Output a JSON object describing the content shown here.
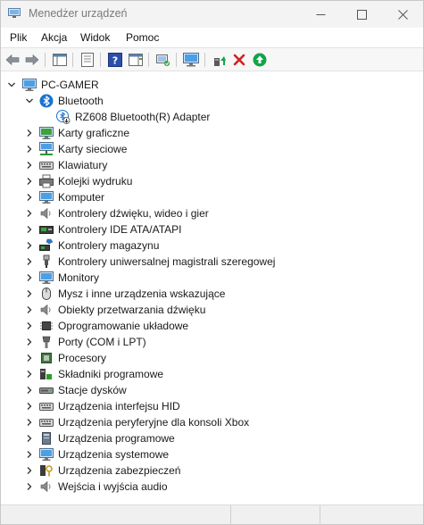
{
  "window": {
    "title": "Menedżer urządzeń"
  },
  "menu": [
    "Plik",
    "Akcja",
    "Widok",
    "Pomoc"
  ],
  "toolbar": {
    "buttons": [
      {
        "name": "back-arrow-icon"
      },
      {
        "name": "forward-arrow-icon"
      },
      {
        "name": "show-hide-console-tree-icon"
      },
      {
        "name": "properties-icon"
      },
      {
        "name": "help-icon"
      },
      {
        "name": "action-pane-icon"
      },
      {
        "name": "scan-hardware-changes-icon"
      },
      {
        "name": "computer-monitor-icon"
      },
      {
        "name": "update-driver-icon"
      },
      {
        "name": "uninstall-device-icon"
      },
      {
        "name": "enable-device-icon"
      }
    ]
  },
  "tree": {
    "root": "PC-GAMER",
    "expanded_category": "Bluetooth",
    "expanded_child": "RZ608 Bluetooth(R) Adapter",
    "categories": [
      {
        "label": "Karty graficzne",
        "icon": "display-adapter-icon"
      },
      {
        "label": "Karty sieciowe",
        "icon": "network-adapter-icon"
      },
      {
        "label": "Klawiatury",
        "icon": "keyboard-icon"
      },
      {
        "label": "Kolejki wydruku",
        "icon": "printer-icon"
      },
      {
        "label": "Komputer",
        "icon": "computer-icon"
      },
      {
        "label": "Kontrolery dźwięku, wideo i gier",
        "icon": "speaker-icon"
      },
      {
        "label": "Kontrolery IDE ATA/ATAPI",
        "icon": "ide-controller-icon"
      },
      {
        "label": "Kontrolery magazynu",
        "icon": "storage-controller-icon"
      },
      {
        "label": "Kontrolery uniwersalnej magistrali szeregowej",
        "icon": "usb-icon"
      },
      {
        "label": "Monitory",
        "icon": "monitor-icon"
      },
      {
        "label": "Mysz i inne urządzenia wskazujące",
        "icon": "mouse-icon"
      },
      {
        "label": "Obiekty przetwarzania dźwięku",
        "icon": "speaker-icon"
      },
      {
        "label": "Oprogramowanie układowe",
        "icon": "firmware-chip-icon"
      },
      {
        "label": "Porty (COM i LPT)",
        "icon": "port-icon"
      },
      {
        "label": "Procesory",
        "icon": "processor-icon"
      },
      {
        "label": "Składniki programowe",
        "icon": "software-component-icon"
      },
      {
        "label": "Stacje dysków",
        "icon": "disk-drive-icon"
      },
      {
        "label": "Urządzenia interfejsu HID",
        "icon": "hid-icon"
      },
      {
        "label": "Urządzenia peryferyjne dla konsoli Xbox",
        "icon": "xbox-peripheral-icon"
      },
      {
        "label": "Urządzenia programowe",
        "icon": "software-device-icon"
      },
      {
        "label": "Urządzenia systemowe",
        "icon": "system-device-icon"
      },
      {
        "label": "Urządzenia zabezpieczeń",
        "icon": "security-device-icon"
      },
      {
        "label": "Wejścia i wyjścia audio",
        "icon": "speaker-icon"
      }
    ]
  },
  "colors": {
    "accent_blue": "#1a73d0",
    "uninstall_red": "#d42020",
    "enable_green": "#16a34a"
  }
}
